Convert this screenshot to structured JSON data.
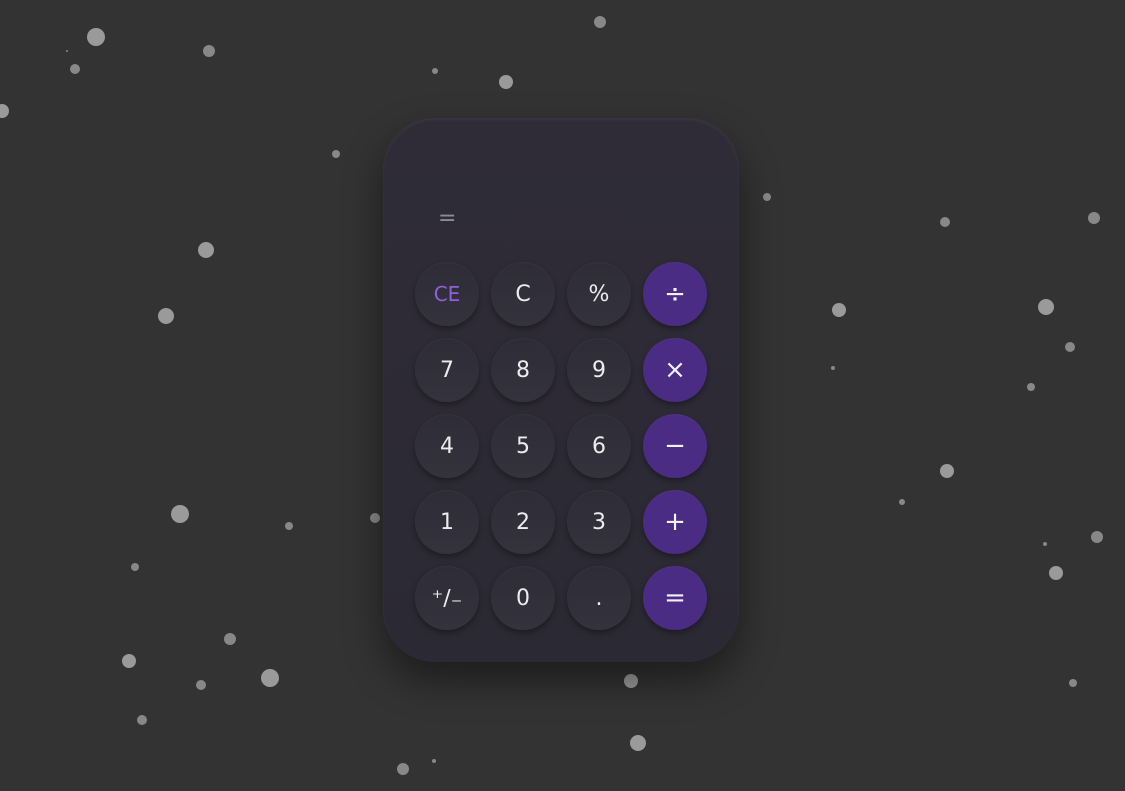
{
  "colors": {
    "background": "#333333",
    "calculator": "#2d2b35",
    "operator": "#4a2c84",
    "ce_text": "#9060d8"
  },
  "display": {
    "expression": "="
  },
  "buttons": [
    {
      "label": "CE",
      "type": "clear-entry"
    },
    {
      "label": "C",
      "type": "clear"
    },
    {
      "label": "%",
      "type": "percent"
    },
    {
      "label": "÷",
      "type": "op"
    },
    {
      "label": "7"
    },
    {
      "label": "8"
    },
    {
      "label": "9"
    },
    {
      "label": "×",
      "type": "op"
    },
    {
      "label": "4"
    },
    {
      "label": "5"
    },
    {
      "label": "6"
    },
    {
      "label": "−",
      "type": "op"
    },
    {
      "label": "1"
    },
    {
      "label": "2"
    },
    {
      "label": "3"
    },
    {
      "label": "+",
      "type": "op"
    },
    {
      "label": "⁺∕₋",
      "type": "sign"
    },
    {
      "label": "0"
    },
    {
      "label": "."
    },
    {
      "label": "=",
      "type": "op"
    }
  ]
}
